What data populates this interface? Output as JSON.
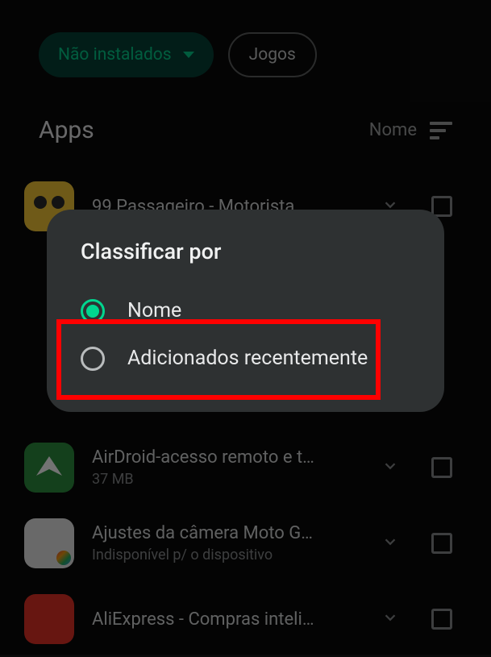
{
  "filters": {
    "not_installed": "Não instalados",
    "games": "Jogos"
  },
  "section": {
    "title": "Apps",
    "sort_label": "Nome"
  },
  "apps": [
    {
      "name": "99 Passageiro - Motorista…",
      "sub": ""
    },
    {
      "name": "AirDroid-acesso remoto e t…",
      "sub": "37 MB"
    },
    {
      "name": "Ajustes da câmera Moto G…",
      "sub": "Indisponível p/ o dispositivo"
    },
    {
      "name": "AliExpress - Compras inteli…",
      "sub": ""
    }
  ],
  "dialog": {
    "title": "Classificar por",
    "options": {
      "name": "Nome",
      "recent": "Adicionados recentemente"
    }
  }
}
